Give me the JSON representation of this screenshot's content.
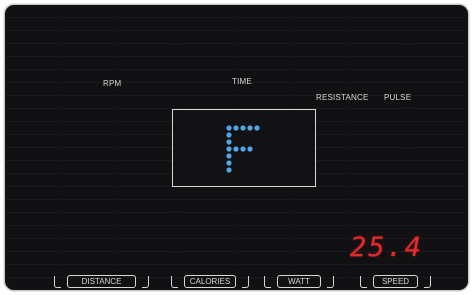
{
  "labels": {
    "rpm": "RPM",
    "time": "TIME",
    "resistance": "RESISTANCE",
    "pulse": "PULSE"
  },
  "matrix_display": {
    "character": "F",
    "dot_color": "#4ea8e8"
  },
  "speed_readout": {
    "value": "25.4",
    "color": "#e42a2a"
  },
  "buttons": {
    "distance": "DISTANCE",
    "calories": "CALORIES",
    "watt": "WATT",
    "speed": "SPEED"
  }
}
